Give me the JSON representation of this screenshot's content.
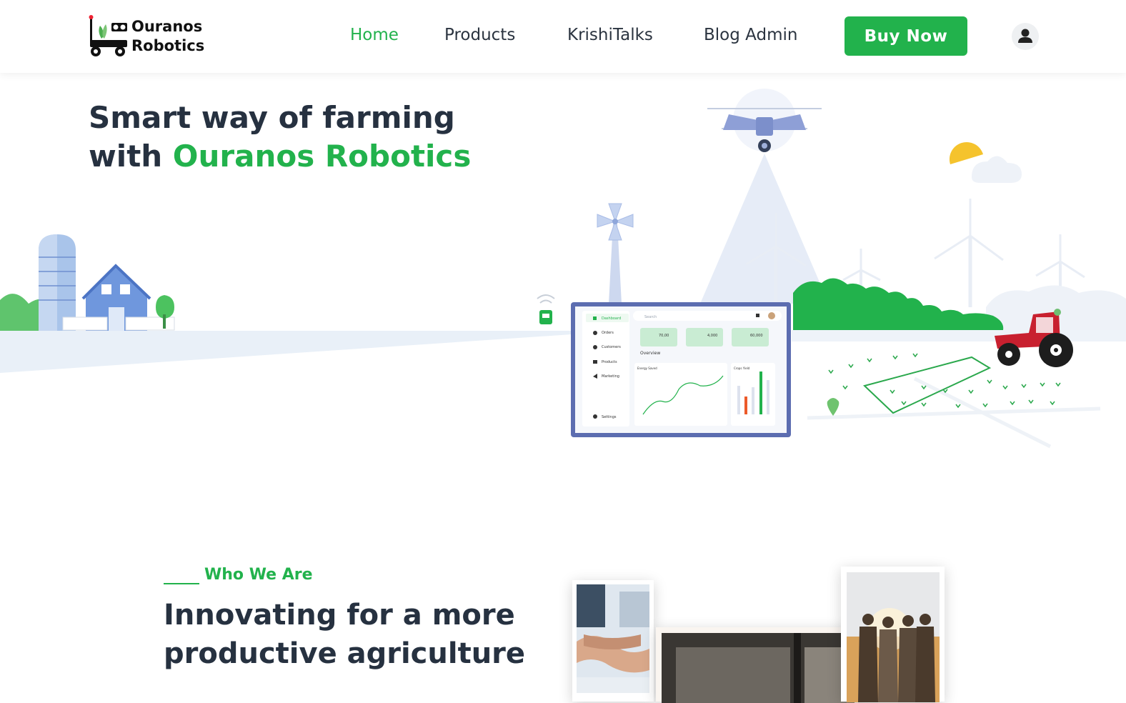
{
  "brand": {
    "name_line1": "Ouranos",
    "name_line2": "Robotics"
  },
  "nav": {
    "items": [
      {
        "label": "Home",
        "active": true
      },
      {
        "label": "Products",
        "active": false
      },
      {
        "label": "KrishiTalks",
        "active": false
      },
      {
        "label": "Blog Admin",
        "active": false
      }
    ],
    "cta_label": "Buy Now",
    "user_icon": "user-icon"
  },
  "hero": {
    "title_line1": "Smart way of farming",
    "title_prefix": "with ",
    "title_accent": "Ouranos Robotics"
  },
  "dashboard": {
    "search_placeholder": "Search",
    "sidebar": [
      "Dashboard",
      "Orders",
      "Customers",
      "Products",
      "Marketing"
    ],
    "settings_label": "Settings",
    "stats": [
      {
        "value": "70,00"
      },
      {
        "value": "4,000"
      },
      {
        "value": "60,000"
      }
    ],
    "overview_label": "Overview",
    "energy_label": "Energy Saved",
    "crops_label": "Crops Yield"
  },
  "about": {
    "tag": "Who We Are",
    "title_line1": "Innovating for a more",
    "title_line2": "productive agriculture"
  },
  "colors": {
    "accent": "#22b24c",
    "text": "#263140",
    "tractor": "#c8202f",
    "drone": "#8e9fd6"
  }
}
